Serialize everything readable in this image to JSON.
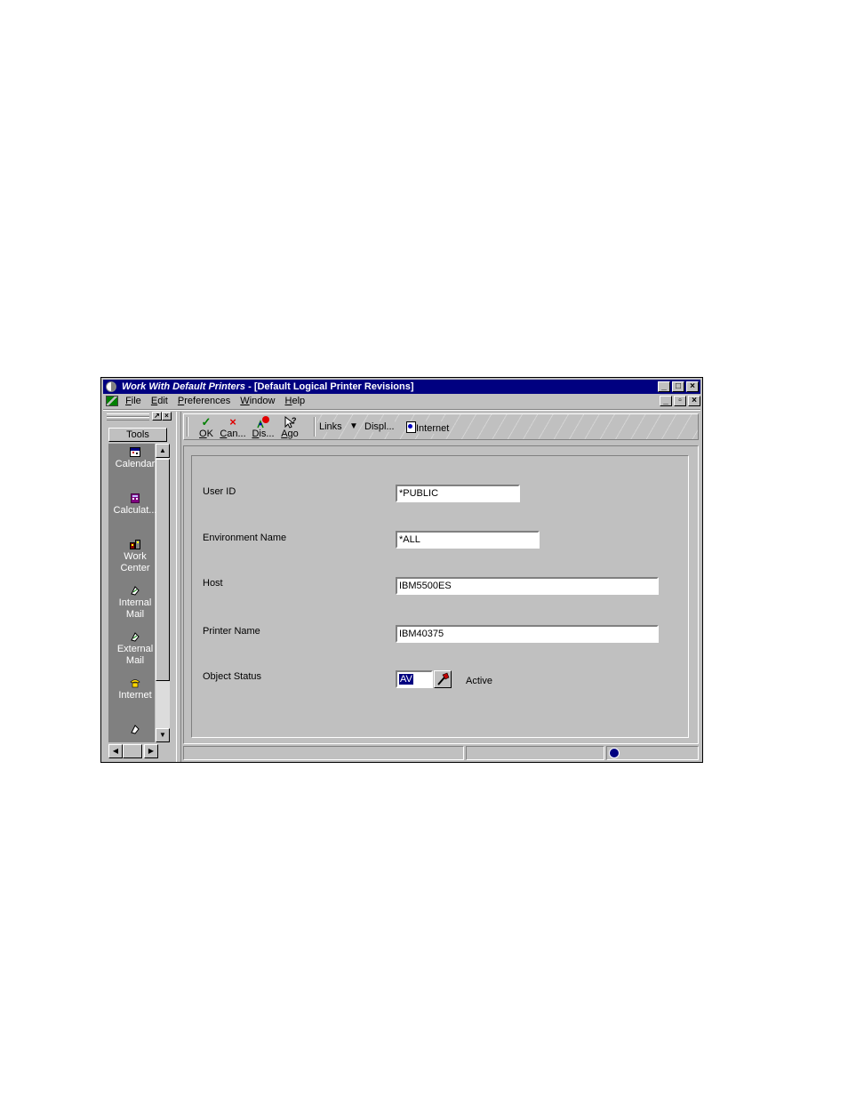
{
  "window": {
    "title_italic": "Work With Default Printers",
    "title_rest": " - [Default Logical Printer Revisions]",
    "caption_buttons": [
      "_",
      "□",
      "×"
    ],
    "mdi_buttons": [
      "_",
      "▫",
      "×"
    ]
  },
  "menu": {
    "items": [
      {
        "accel": "F",
        "rest": "ile"
      },
      {
        "accel": "E",
        "rest": "dit"
      },
      {
        "accel": "P",
        "rest": "references"
      },
      {
        "accel": "W",
        "rest": "indow"
      },
      {
        "accel": "H",
        "rest": "elp"
      }
    ]
  },
  "tools": {
    "header": "Tools",
    "items": [
      {
        "line1": "Calendar",
        "line2": "",
        "icon": "calendar-icon"
      },
      {
        "line1": "Calculat...",
        "line2": "",
        "icon": "calculator-icon"
      },
      {
        "line1": "Work",
        "line2": "Center",
        "icon": "work-center-icon"
      },
      {
        "line1": "Internal",
        "line2": "Mail",
        "icon": "internal-mail-icon"
      },
      {
        "line1": "External",
        "line2": "Mail",
        "icon": "external-mail-icon"
      },
      {
        "line1": "Internet",
        "line2": "",
        "icon": "internet-phone-icon"
      }
    ]
  },
  "toolbar": {
    "ok_accel": "O",
    "ok_rest": "K",
    "cancel_accel": "C",
    "cancel_rest": "an...",
    "display_accel": "D",
    "display_rest": "is...",
    "ago_accel": "A",
    "ago_rest": "go",
    "links": "Links",
    "display": "Displ...",
    "internet": "Internet"
  },
  "form": {
    "user_id_label": "User ID",
    "user_id_value": "*PUBLIC",
    "environment_label": "Environment Name",
    "environment_value": "*ALL",
    "host_label": "Host",
    "host_value": "IBM5500ES",
    "printer_label": "Printer Name",
    "printer_value": "IBM40375",
    "status_label": "Object Status",
    "status_value": "AV",
    "status_description": "Active"
  }
}
